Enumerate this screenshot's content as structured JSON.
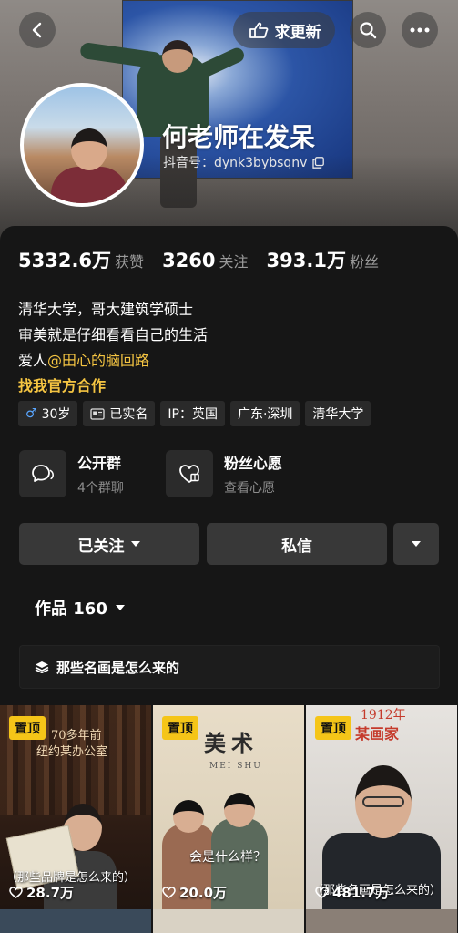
{
  "header": {
    "update_label": "求更新",
    "username": "何老师在发呆",
    "douyin_id": "抖音号：dynk3bybsqnv"
  },
  "stats": {
    "likes_num": "5332.6万",
    "likes_label": "获赞",
    "following_num": "3260",
    "following_label": "关注",
    "fans_num": "393.1万",
    "fans_label": "粉丝"
  },
  "bio": {
    "line1": "清华大学，哥大建筑学硕士",
    "line2": "审美就是仔细看看自己的生活",
    "line3_prefix": "爱人",
    "line3_mention": "@田心的脑回路",
    "line4": "找我官方合作"
  },
  "tags": {
    "age": "30岁",
    "verified": "已实名",
    "ip": "IP：英国",
    "location": "广东·深圳",
    "school": "清华大学"
  },
  "features": {
    "group_title": "公开群",
    "group_sub": "4个群聊",
    "wish_title": "粉丝心愿",
    "wish_sub": "查看心愿"
  },
  "actions": {
    "follow_label": "已关注",
    "message_label": "私信"
  },
  "works": {
    "tab_label": "作品 160",
    "collection_label": "那些名画是怎么来的"
  },
  "videos": [
    {
      "pin": "置顶",
      "caption_line1": "70多年前",
      "caption_line2": "纽约某办公室",
      "subtitle": "（那些品牌是怎么来的）",
      "likes": "28.7万"
    },
    {
      "pin": "置顶",
      "caption_title": "美术",
      "caption_roman": "MEI SHU",
      "subtitle": "会是什么样？",
      "likes": "20.0万"
    },
    {
      "pin": "置顶",
      "caption_line1": "1912年",
      "caption_line2": "某画家",
      "subtitle": "（那些名画是怎么来的）",
      "likes": "481.7万"
    }
  ],
  "colors": {
    "accent_yellow": "#f5c542",
    "pin_yellow": "#f5c518",
    "male_blue": "#59a6ff",
    "background": "#161616"
  }
}
